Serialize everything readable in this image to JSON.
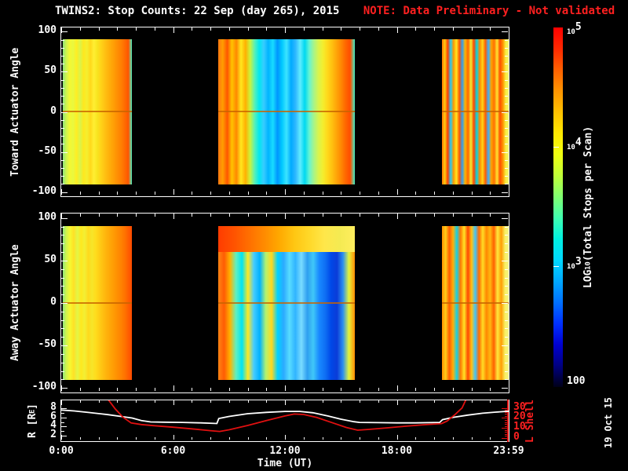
{
  "title": {
    "main": "TWINS2: Stop Counts: 22 Sep (day 265), 2015",
    "note": "NOTE: Data Preliminary - Not validated"
  },
  "colors": {
    "background": "#000000",
    "frame": "#ffffff",
    "note_red": "#ff2020",
    "r_curve": "#ffffff",
    "l_curve": "#e01010",
    "zero_line": "rgba(200,100,0,0.8)"
  },
  "time_axis": {
    "label": "Time (UT)",
    "span_hours": 24,
    "ticks": [
      {
        "hour": 0,
        "label": "0:00"
      },
      {
        "hour": 6,
        "label": "6:00"
      },
      {
        "hour": 12,
        "label": "12:00"
      },
      {
        "hour": 18,
        "label": "18:00"
      },
      {
        "hour": 24,
        "label": "23:59"
      }
    ]
  },
  "datestamp": "19 Oct 15",
  "colorbar": {
    "label_prefix": "LOG",
    "label_sub": "10",
    "label_suffix": "(Total Stops per Scan)",
    "log_range": [
      2,
      5
    ],
    "ticks": [
      {
        "base": "10",
        "exp": "5",
        "logval": 5
      },
      {
        "base": "10",
        "exp": "4",
        "logval": 4
      },
      {
        "base": "10",
        "exp": "3",
        "logval": 3
      },
      {
        "base": "100",
        "exp": "",
        "logval": 2
      }
    ],
    "gradient_bottom_to_top": [
      "#000018",
      "#000080",
      "#0000d0",
      "#0030ff",
      "#0070ff",
      "#00a8ff",
      "#00d8ff",
      "#00f0e0",
      "#40ffb0",
      "#80ff70",
      "#c0ff38",
      "#f0ff10",
      "#ffe800",
      "#ffc000",
      "#ff9400",
      "#ff6000",
      "#ff2800",
      "#ff0000"
    ]
  },
  "bottom_panel": {
    "left_axis": {
      "label_main": "R [R",
      "label_sub": "E",
      "label_close": "]",
      "ticks": [
        "8",
        "6",
        "4",
        "2"
      ],
      "tick_values": [
        8,
        6,
        4,
        2
      ],
      "range": [
        2,
        8
      ]
    },
    "right_axis": {
      "label": "L Shell",
      "ticks": [
        "30",
        "20",
        "10",
        "0"
      ],
      "tick_values": [
        30,
        20,
        10,
        0
      ],
      "range": [
        0,
        30
      ]
    }
  },
  "chart_data": [
    {
      "type": "heatmap",
      "title": "Toward Actuator Angle",
      "xlabel": "Time (UT)",
      "x_range_hours": [
        0,
        24
      ],
      "y_range_deg": [
        -100,
        100
      ],
      "data_angle_extent": [
        90,
        -90
      ],
      "yticks": [
        "100",
        "50",
        "0",
        "-50",
        "-100"
      ],
      "ytick_values": [
        100,
        50,
        0,
        -50,
        -100
      ],
      "value_scale": "LOG10(Total Stops per Scan)",
      "value_range": [
        100,
        100000
      ],
      "segments": [
        {
          "t_start": 0.1,
          "t_end": 3.8,
          "zero_line": true,
          "stripes": [
            "#8ee67a",
            "#cdf24f",
            "#f4f832",
            "#e8f840",
            "#ffee22",
            "#d9f44a",
            "#ffe81e",
            "#f4ef30",
            "#ffd91a",
            "#ffee33",
            "#f8e41f",
            "#ffd418",
            "#ffc414",
            "#ffb60d",
            "#ffa808",
            "#ff9a05",
            "#ff8c03",
            "#ff7e02",
            "#ff6a01",
            "#ff5500",
            "#49f2c2"
          ]
        },
        {
          "t_start": 8.4,
          "t_end": 15.75,
          "zero_line": true,
          "stripes": [
            "#ff7710",
            "#ff9e00",
            "#ff5500",
            "#ffc400",
            "#ff8800",
            "#ffe81e",
            "#ffb000",
            "#caf43c",
            "#58f0b8",
            "#00e8f0",
            "#38ccff",
            "#00b4ff",
            "#18dcff",
            "#0096ff",
            "#00c8ff",
            "#3ce4ff",
            "#00aaff",
            "#30b8ff",
            "#60ecff",
            "#00d8f0",
            "#66f4d2",
            "#a8f488",
            "#d8f44e",
            "#f4ee2e",
            "#ffd81a",
            "#ffc010",
            "#ffa408",
            "#ff8802",
            "#ff6600",
            "#ff4d00",
            "#3cf2c8"
          ]
        },
        {
          "t_start": 20.4,
          "t_end": 24,
          "zero_line": true,
          "stripes": [
            "#ff7700",
            "#ffcc11",
            "#ff3c00",
            "#22ccf8",
            "#ff9900",
            "#ffe822",
            "#ff5500",
            "#2f9ff5",
            "#ffb300",
            "#ff6600",
            "#f2ee33",
            "#ff4400",
            "#00d8e8",
            "#ff8800",
            "#ffd518",
            "#ff5c00",
            "#38b0ff",
            "#ffa200",
            "#ff7000",
            "#ffe430",
            "#ff4c00",
            "#ff9400",
            "#f8ef40",
            "#f6f268"
          ]
        }
      ]
    },
    {
      "type": "heatmap",
      "title": "Away Actuator Angle",
      "xlabel": "Time (UT)",
      "x_range_hours": [
        0,
        24
      ],
      "y_range_deg": [
        -100,
        100
      ],
      "data_angle_extent": [
        90,
        -90
      ],
      "yticks": [
        "100",
        "50",
        "0",
        "-50",
        "-100"
      ],
      "ytick_values": [
        100,
        50,
        0,
        -50,
        -100
      ],
      "value_scale": "LOG10(Total Stops per Scan)",
      "value_range": [
        100,
        100000
      ],
      "segments": [
        {
          "t_start": 0.1,
          "t_end": 3.8,
          "zero_line": true,
          "stripes": [
            "#90e87c",
            "#d2f44c",
            "#f6f930",
            "#ffe026",
            "#e2f646",
            "#ffe81e",
            "#f2ef34",
            "#ffd91c",
            "#f6e62a",
            "#ffdd1d",
            "#ffce16",
            "#ffc011",
            "#ffb30c",
            "#ffa707",
            "#ff9b04",
            "#ff8f02",
            "#ff8301",
            "#ff7300",
            "#ff5f00",
            "#ff4a00"
          ]
        },
        {
          "t_start": 8.4,
          "t_end": 15.75,
          "zero_line": true,
          "top_band": {
            "height_frac": 0.17,
            "stripes": [
              "#ff3c00",
              "#ff5200",
              "#ff6e00",
              "#ff8a00",
              "#ffa800",
              "#ffc612",
              "#ffd829",
              "#ffe74a",
              "#f4ea52",
              "#ffee5e"
            ]
          },
          "stripes": [
            "#ff8412",
            "#ff5c04",
            "#ffb400",
            "#5ff0c0",
            "#00e4f4",
            "#ffe822",
            "#46ccff",
            "#00b2ff",
            "#b2f470",
            "#ffd81e",
            "#00d2ff",
            "#2baaff",
            "#58dcff",
            "#30b4ff",
            "#7adcff",
            "#2f9ff0",
            "#40c8f8",
            "#1888ff",
            "#0f70f4",
            "#0048e8",
            "#0a3cd8",
            "#2b8ff0",
            "#e4f43a",
            "#ff8c04"
          ]
        },
        {
          "t_start": 20.4,
          "t_end": 24,
          "zero_line": true,
          "stripes": [
            "#ff9000",
            "#ffcc18",
            "#ff5c00",
            "#ffb008",
            "#12d2e8",
            "#ff7a00",
            "#ffe426",
            "#ff4800",
            "#ffc212",
            "#42c4f8",
            "#ff6a00",
            "#ffdd26",
            "#ff8800",
            "#ffb810",
            "#ff6000",
            "#ffe83c",
            "#ff9c04",
            "#f8f060",
            "#f6f386"
          ]
        }
      ]
    },
    {
      "type": "line",
      "xlabel": "Time (UT)",
      "x_range_hours": [
        0,
        24
      ],
      "series": [
        {
          "name": "R [Re]",
          "color": "#ffffff",
          "axis": "left",
          "ylim": [
            2,
            8
          ],
          "points": [
            [
              0,
              7.6
            ],
            [
              0.7,
              7.4
            ],
            [
              1.5,
              7.05
            ],
            [
              2.5,
              6.6
            ],
            [
              3.2,
              6.2
            ],
            [
              3.8,
              5.85
            ],
            [
              4.3,
              5.3
            ],
            [
              4.8,
              5.0
            ],
            [
              5.5,
              4.95
            ],
            [
              6.5,
              4.9
            ],
            [
              7.5,
              4.8
            ],
            [
              8.35,
              4.65
            ],
            [
              8.45,
              5.75
            ],
            [
              9,
              6.2
            ],
            [
              10,
              6.8
            ],
            [
              11,
              7.1
            ],
            [
              12,
              7.3
            ],
            [
              12.8,
              7.3
            ],
            [
              13.5,
              7.0
            ],
            [
              14.3,
              6.3
            ],
            [
              15,
              5.6
            ],
            [
              15.7,
              5.05
            ],
            [
              16,
              4.9
            ],
            [
              17,
              4.85
            ],
            [
              18,
              4.8
            ],
            [
              19,
              4.8
            ],
            [
              20.3,
              4.9
            ],
            [
              20.45,
              5.5
            ],
            [
              21,
              6.0
            ],
            [
              21.8,
              6.5
            ],
            [
              22.6,
              6.9
            ],
            [
              23.3,
              7.15
            ],
            [
              24,
              7.35
            ]
          ]
        },
        {
          "name": "L Shell",
          "color": "#e01010",
          "axis": "right",
          "ylim": [
            0,
            30
          ],
          "points": [
            [
              2.45,
              40
            ],
            [
              2.9,
              29
            ],
            [
              3.3,
              21
            ],
            [
              3.75,
              15
            ],
            [
              4.3,
              13.5
            ],
            [
              5,
              12.3
            ],
            [
              6,
              10.8
            ],
            [
              7,
              9.2
            ],
            [
              8,
              7.4
            ],
            [
              8.5,
              6.6
            ],
            [
              9,
              8.2
            ],
            [
              10,
              12.5
            ],
            [
              11,
              17.5
            ],
            [
              12,
              22
            ],
            [
              12.5,
              24
            ],
            [
              13,
              23.5
            ],
            [
              13.7,
              20.5
            ],
            [
              14.5,
              15.5
            ],
            [
              15.3,
              10.5
            ],
            [
              15.9,
              7.8
            ],
            [
              16.5,
              8.6
            ],
            [
              17.5,
              10.2
            ],
            [
              18.5,
              11.8
            ],
            [
              19.5,
              13.3
            ],
            [
              20.4,
              14.4
            ],
            [
              20.7,
              17
            ],
            [
              21.1,
              23
            ],
            [
              21.5,
              30
            ],
            [
              21.75,
              40
            ]
          ]
        }
      ]
    }
  ]
}
